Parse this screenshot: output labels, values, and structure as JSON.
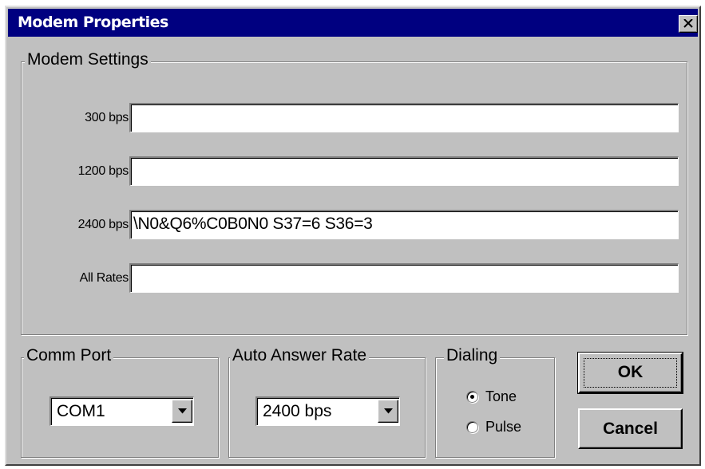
{
  "window": {
    "title": "Modem Properties"
  },
  "modem_settings": {
    "legend": "Modem Settings",
    "rows": [
      {
        "label": "300 bps",
        "value": ""
      },
      {
        "label": "1200 bps",
        "value": ""
      },
      {
        "label": "2400 bps",
        "value": "\\N0&Q6%C0B0N0 S37=6 S36=3"
      },
      {
        "label": "All Rates",
        "value": ""
      }
    ]
  },
  "comm_port": {
    "legend": "Comm Port",
    "selected": "COM1"
  },
  "auto_answer": {
    "legend": "Auto Answer Rate",
    "selected": "2400 bps"
  },
  "dialing": {
    "legend": "Dialing",
    "options": [
      {
        "label": "Tone",
        "checked": true
      },
      {
        "label": "Pulse",
        "checked": false
      }
    ]
  },
  "buttons": {
    "ok": "OK",
    "cancel": "Cancel"
  },
  "icons": {
    "close": "close-icon",
    "dropdown": "chevron-down-icon"
  },
  "colors": {
    "titlebar": "#000080",
    "face": "#c0c0c0"
  }
}
